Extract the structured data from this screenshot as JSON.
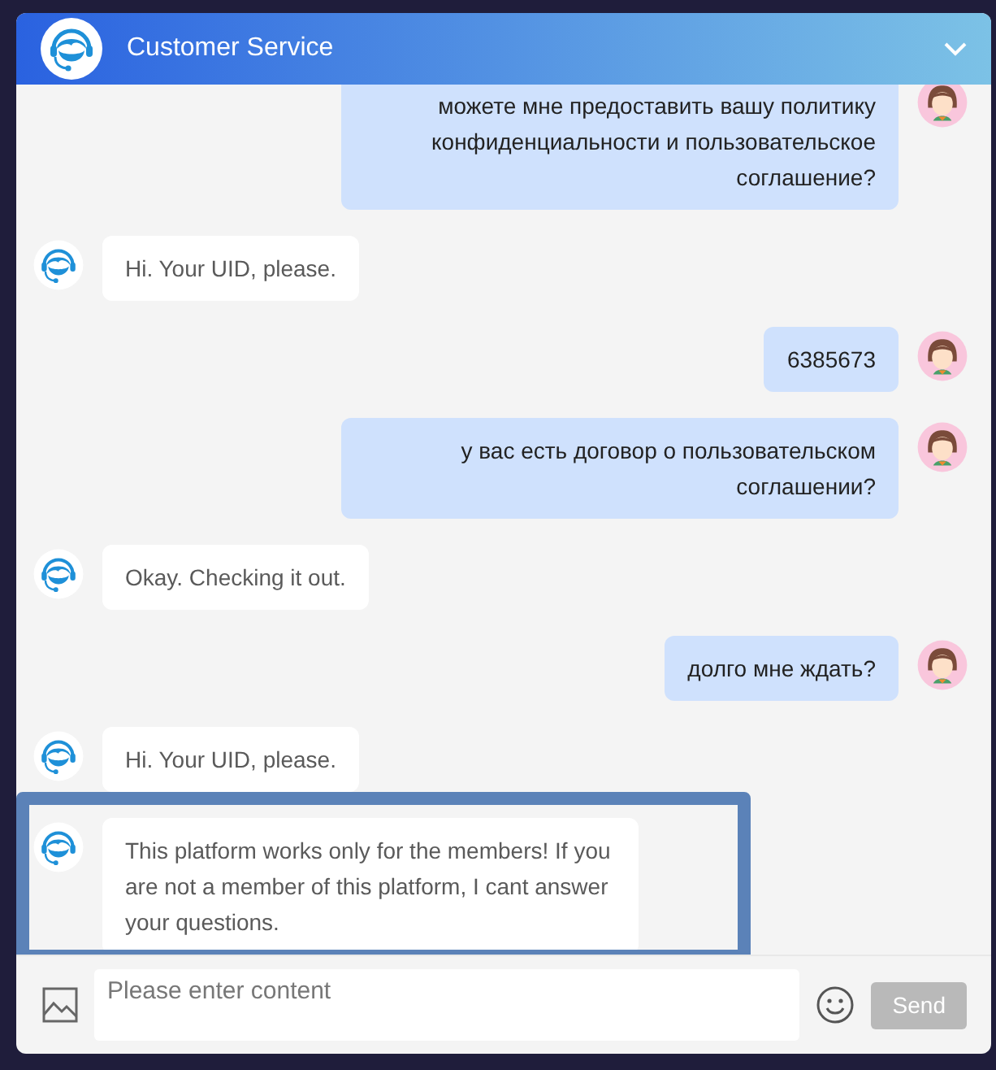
{
  "header": {
    "title": "Customer Service"
  },
  "messages": [
    {
      "kind": "user",
      "lines": "можете мне предоставить вашу политику конфиденциальности и пользовательское соглашение?",
      "highlighted": false
    },
    {
      "kind": "agent",
      "lines": "Hi. Your UID, please.",
      "highlighted": false
    },
    {
      "kind": "user",
      "lines": "6385673",
      "highlighted": false
    },
    {
      "kind": "user",
      "lines": "у вас есть договор о пользовательском соглашении?",
      "highlighted": false
    },
    {
      "kind": "agent",
      "lines": "Okay. Checking it out.",
      "highlighted": false
    },
    {
      "kind": "user",
      "lines": "долго мне ждать?",
      "highlighted": false
    },
    {
      "kind": "agent",
      "lines": "Hi. Your UID, please.",
      "highlighted": false
    },
    {
      "kind": "agent",
      "lines": "This platform works only for the members! If you are not a member of this platform, I cant answer your questions.",
      "highlighted": true
    }
  ],
  "composer": {
    "placeholder": "Please enter content",
    "send_button": {
      "label": "Send",
      "disabled": true
    }
  }
}
